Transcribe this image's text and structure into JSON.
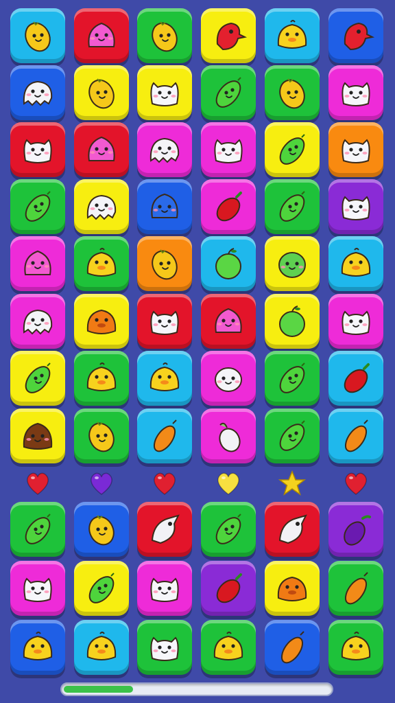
{
  "board": {
    "upper_rows": [
      [
        {
          "color": "cyan",
          "icon": "yellow-lemon"
        },
        {
          "color": "red",
          "icon": "pink-blob"
        },
        {
          "color": "green",
          "icon": "yellow-lemon"
        },
        {
          "color": "yellow",
          "icon": "red-parrot"
        },
        {
          "color": "cyan",
          "icon": "yellow-chick"
        },
        {
          "color": "blue",
          "icon": "red-parrot"
        }
      ],
      [
        {
          "color": "blue",
          "icon": "white-ghost"
        },
        {
          "color": "yellow",
          "icon": "yellow-lemon"
        },
        {
          "color": "yellow",
          "icon": "white-cat"
        },
        {
          "color": "green",
          "icon": "green-lime"
        },
        {
          "color": "green",
          "icon": "yellow-lemon"
        },
        {
          "color": "magenta",
          "icon": "white-cat"
        }
      ],
      [
        {
          "color": "red",
          "icon": "white-cat"
        },
        {
          "color": "red",
          "icon": "pink-blob"
        },
        {
          "color": "magenta",
          "icon": "white-ghost"
        },
        {
          "color": "magenta",
          "icon": "white-cat"
        },
        {
          "color": "yellow",
          "icon": "green-lime"
        },
        {
          "color": "orange",
          "icon": "white-cat"
        }
      ],
      [
        {
          "color": "green",
          "icon": "green-lime"
        },
        {
          "color": "yellow",
          "icon": "white-ghost"
        },
        {
          "color": "blue",
          "icon": "blue-blob"
        },
        {
          "color": "magenta",
          "icon": "red-pepper"
        },
        {
          "color": "green",
          "icon": "green-lime"
        },
        {
          "color": "purple",
          "icon": "white-cat"
        }
      ],
      [
        {
          "color": "magenta",
          "icon": "pink-blob"
        },
        {
          "color": "green",
          "icon": "yellow-chick"
        },
        {
          "color": "orange",
          "icon": "yellow-lemon"
        },
        {
          "color": "cyan",
          "icon": "green-apple"
        },
        {
          "color": "yellow",
          "icon": "green-blob"
        },
        {
          "color": "cyan",
          "icon": "yellow-chick"
        }
      ],
      [
        {
          "color": "magenta",
          "icon": "white-ghost"
        },
        {
          "color": "yellow",
          "icon": "orange-chick"
        },
        {
          "color": "red",
          "icon": "white-cat"
        },
        {
          "color": "red",
          "icon": "pink-blob"
        },
        {
          "color": "yellow",
          "icon": "green-apple"
        },
        {
          "color": "magenta",
          "icon": "white-cat"
        }
      ],
      [
        {
          "color": "yellow",
          "icon": "green-lime"
        },
        {
          "color": "green",
          "icon": "yellow-chick"
        },
        {
          "color": "cyan",
          "icon": "yellow-chick"
        },
        {
          "color": "magenta",
          "icon": "white-blob"
        },
        {
          "color": "green",
          "icon": "green-lime"
        },
        {
          "color": "cyan",
          "icon": "red-pepper"
        }
      ],
      [
        {
          "color": "yellow",
          "icon": "brown-coconut"
        },
        {
          "color": "green",
          "icon": "yellow-lemon"
        },
        {
          "color": "cyan",
          "icon": "orange-carrot"
        },
        {
          "color": "magenta",
          "icon": "white-eggplant"
        },
        {
          "color": "green",
          "icon": "green-lime"
        },
        {
          "color": "cyan",
          "icon": "orange-carrot"
        }
      ]
    ],
    "markers": [
      {
        "icon": "heart",
        "color": "#e02030"
      },
      {
        "icon": "heart",
        "color": "#7a2ad6"
      },
      {
        "icon": "heart",
        "color": "#e02030"
      },
      {
        "icon": "heart",
        "color": "#f7e040"
      },
      {
        "icon": "star",
        "color": "#f5d21e"
      },
      {
        "icon": "heart",
        "color": "#e02030"
      }
    ],
    "lower_rows": [
      [
        {
          "color": "green",
          "icon": "green-lime"
        },
        {
          "color": "blue",
          "icon": "yellow-lemon"
        },
        {
          "color": "red",
          "icon": "white-bird"
        },
        {
          "color": "green",
          "icon": "green-lime"
        },
        {
          "color": "red",
          "icon": "white-bird"
        },
        {
          "color": "purple",
          "icon": "purple-eggplant"
        }
      ],
      [
        {
          "color": "magenta",
          "icon": "white-cat"
        },
        {
          "color": "yellow",
          "icon": "green-lime"
        },
        {
          "color": "magenta",
          "icon": "white-cat"
        },
        {
          "color": "purple",
          "icon": "red-pepper"
        },
        {
          "color": "yellow",
          "icon": "orange-chick"
        },
        {
          "color": "green",
          "icon": "orange-carrot"
        }
      ],
      [
        {
          "color": "blue",
          "icon": "yellow-chick"
        },
        {
          "color": "cyan",
          "icon": "yellow-chick"
        },
        {
          "color": "green",
          "icon": "white-cat"
        },
        {
          "color": "green",
          "icon": "yellow-chick"
        },
        {
          "color": "blue",
          "icon": "orange-carrot"
        },
        {
          "color": "green",
          "icon": "yellow-chick"
        }
      ]
    ]
  },
  "progress": {
    "fraction": 0.26,
    "track_color": "#e8ecf4",
    "fill_color": "#3cc24a"
  },
  "palette": {
    "cyan": "#1fb8ec",
    "red": "#e3142a",
    "green": "#1ec23a",
    "yellow": "#f7ee10",
    "blue": "#1f5fe6",
    "magenta": "#ee2bd8",
    "orange": "#f98a10",
    "purple": "#8a2bd6",
    "background": "#3f4aa8"
  }
}
